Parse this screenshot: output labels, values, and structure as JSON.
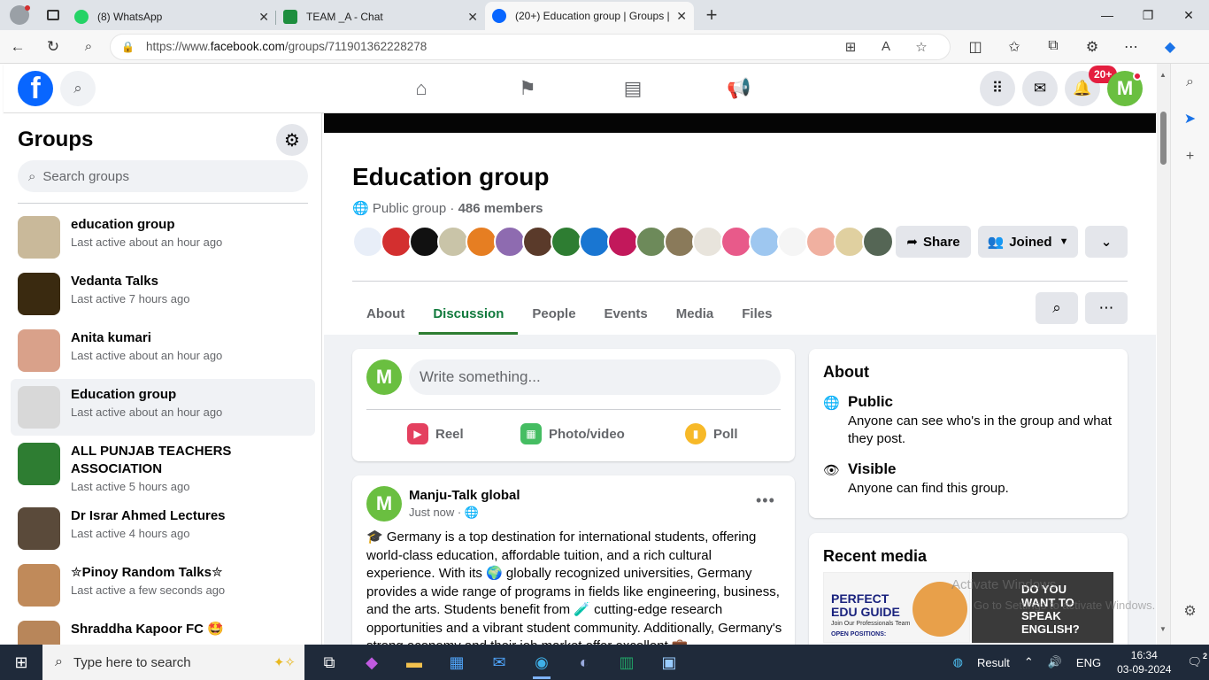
{
  "browser": {
    "tabs": [
      {
        "title": "(8) WhatsApp",
        "color": "#25d366"
      },
      {
        "title": "TEAM _A - Chat",
        "color": "#1e8e3e"
      },
      {
        "title": "(20+) Education group | Groups |",
        "color": "#0866ff"
      }
    ],
    "url_prefix": "https://www.",
    "url_host": "facebook.com",
    "url_path": "/groups/711901362228278"
  },
  "header": {
    "notifications_badge": "20+",
    "avatar_letter": "M"
  },
  "sidebar": {
    "title": "Groups",
    "search_placeholder": "Search groups",
    "groups": [
      {
        "name": "education group",
        "last_active": "Last active about an hour ago",
        "color": "#c9b99a"
      },
      {
        "name": "Vedanta Talks",
        "last_active": "Last active 7 hours ago",
        "color": "#3a2a10"
      },
      {
        "name": "Anita kumari",
        "last_active": "Last active about an hour ago",
        "color": "#d9a18a"
      },
      {
        "name": "Education group",
        "last_active": "Last active about an hour ago",
        "color": "#d8d8d8"
      },
      {
        "name": "ALL PUNJAB TEACHERS ASSOCIATION",
        "last_active": "Last active 5 hours ago",
        "color": "#2e7d32"
      },
      {
        "name": "Dr Israr Ahmed Lectures",
        "last_active": "Last active 4 hours ago",
        "color": "#5a4a3a"
      },
      {
        "name": "✮Pinoy Random Talks✮",
        "last_active": "Last active a few seconds ago",
        "color": "#c08a5a"
      },
      {
        "name": "Shraddha Kapoor FC 🤩",
        "last_active": "",
        "color": "#b8865a"
      }
    ]
  },
  "group": {
    "title": "Education group",
    "privacy": "Public group",
    "separator": " · ",
    "members": "486 members",
    "share_label": "Share",
    "joined_label": "Joined",
    "tabs": [
      "About",
      "Discussion",
      "People",
      "Events",
      "Media",
      "Files"
    ],
    "member_avatar_colors": [
      "#e8eef8",
      "#d32f2f",
      "#111111",
      "#c9c4a8",
      "#e67e22",
      "#8e6bb0",
      "#5a3a2a",
      "#2e7d32",
      "#1976d2",
      "#c2185b",
      "#6d8a5a",
      "#8a7a5a",
      "#e8e4dc",
      "#e85a8a",
      "#9ec7f0",
      "#f5f5f5",
      "#f0b0a0",
      "#e0d0a0",
      "#556655"
    ]
  },
  "composer": {
    "avatar_letter": "M",
    "placeholder": "Write something...",
    "actions": [
      {
        "label": "Reel",
        "color": "#e4405f"
      },
      {
        "label": "Photo/video",
        "color": "#45bd62"
      },
      {
        "label": "Poll",
        "color": "#f7b928"
      }
    ]
  },
  "post": {
    "avatar_letter": "M",
    "author": "Manju-Talk global",
    "time": "Just now · 🌐",
    "text": "🎓 Germany is a top destination for international students, offering world-class education, affordable tuition, and a rich cultural experience. With its 🌍 globally recognized universities, Germany provides a wide range of programs in fields like engineering, business, and the arts. Students benefit from 🧪 cutting-edge research opportunities and a vibrant student community. Additionally, Germany's strong economy and their job market offer excellent 💼"
  },
  "about": {
    "title": "About",
    "items": [
      {
        "heading": "Public",
        "desc": "Anyone can see who's in the group and what they post."
      },
      {
        "heading": "Visible",
        "desc": "Anyone can find this group."
      }
    ]
  },
  "recent_media": {
    "title": "Recent media",
    "images": [
      {
        "caption": "PERFECT EDU GUIDE",
        "sub": "Join Our Professionals Team",
        "extra": "OPEN POSITIONS:"
      },
      {
        "caption": "DO YOU WANT TO SPEAK ENGLISH?"
      }
    ]
  },
  "watermark": {
    "line1": "Activate Windows",
    "line2": "Go to Settings to activate Windows."
  },
  "taskbar": {
    "search_placeholder": "Type here to search",
    "weather": "Result",
    "lang": "ENG",
    "time": "16:34",
    "date": "03-09-2024",
    "notif_count": "2"
  }
}
